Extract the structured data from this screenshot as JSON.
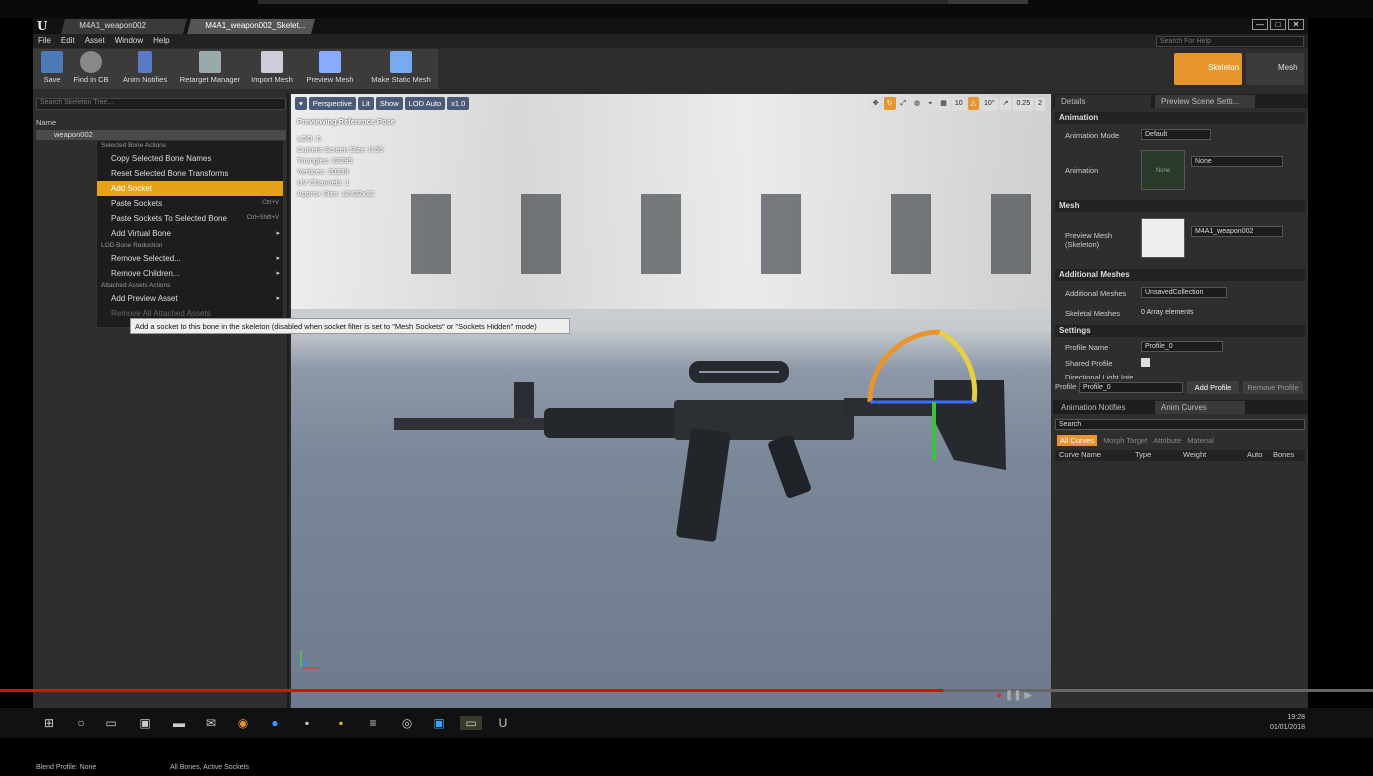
{
  "window": {
    "tabs": [
      "M4A1_weapon002",
      "M4A1_weapon002_Skelet..."
    ],
    "help_search": "Search For Help",
    "win_buttons": [
      "—",
      "□",
      "✕"
    ]
  },
  "menu": [
    "File",
    "Edit",
    "Asset",
    "Window",
    "Help"
  ],
  "toolbar": {
    "save": "Save",
    "find_in_cb": "Find in CB",
    "anim_notifies": "Anim Notifies",
    "retarget_manager": "Retarget Manager",
    "import_mesh": "Import Mesh",
    "preview_mesh": "Preview Mesh",
    "make_static_mesh": "Make Static Mesh"
  },
  "modes": {
    "skeleton": "Skeleton",
    "mesh": "Mesh"
  },
  "skeleton_tree": {
    "search_placeholder": "Search Skeleton Tree...",
    "column_name": "Name",
    "root_bone": "weapon002",
    "footer_left": "Blend Profile: None",
    "footer_right": "All Bones, Active Sockets"
  },
  "context_menu": {
    "sections": [
      {
        "header": "Selected Bone Actions",
        "items": [
          {
            "label": "Copy Selected Bone Names"
          },
          {
            "label": "Reset Selected Bone Transforms"
          },
          {
            "label": "Add Socket",
            "selected": true
          },
          {
            "label": "Paste Sockets",
            "shortcut": "Ctrl+V"
          },
          {
            "label": "Paste Sockets To Selected Bone",
            "shortcut": "Ctrl+Shift+V"
          },
          {
            "label": "Add Virtual Bone",
            "submenu": true
          }
        ]
      },
      {
        "header": "LOD Bone Reduction",
        "items": [
          {
            "label": "Remove Selected...",
            "submenu": true
          },
          {
            "label": "Remove Children...",
            "submenu": true
          }
        ]
      },
      {
        "header": "Attached Assets Actions",
        "items": [
          {
            "label": "Add Preview Asset",
            "submenu": true
          },
          {
            "label": "Remove All Attached Assets",
            "disabled": true
          }
        ]
      }
    ]
  },
  "tooltip": "Add a socket to this bone in the skeleton (disabled when socket filter is set to \"Mesh Sockets\" or \"Sockets Hidden\" mode)",
  "viewport": {
    "perspective": "Perspective",
    "lit": "Lit",
    "show": "Show",
    "lod": "LOD Auto",
    "speed": "x1.0",
    "info_title": "Previewing Reference Pose",
    "info_lines": [
      "LOD: 0",
      "Current Screen Size: 0.55",
      "Triangles: 23295",
      "Vertices: 20239",
      "UV Channels: 1",
      "Approx Size: 12x32x12"
    ],
    "grid_snap": "10",
    "rot_snap": "10°",
    "scale_snap": "0.25",
    "cam_speed": "2"
  },
  "details": {
    "tab_details": "Details",
    "tab_preview": "Preview Scene Setti...",
    "animation_section": "Animation",
    "animation_mode_label": "Animation Mode",
    "animation_mode_value": "Default",
    "animation_label": "Animation",
    "animation_value": "None",
    "animation_thumb": "None",
    "mesh_section": "Mesh",
    "preview_mesh_label": "Preview Mesh (Skeleton)",
    "preview_mesh_value": "M4A1_weapon002",
    "additional_section": "Additional Meshes",
    "additional_label": "Additional Meshes",
    "additional_value": "UnsavedCollection",
    "skeletal_label": "Skeletal Meshes",
    "skeletal_value": "0 Array elements",
    "settings_section": "Settings",
    "profile_name_label": "Profile Name",
    "profile_name_value": "Profile_0",
    "shared_profile_label": "Shared Profile",
    "directional_label": "Directional Light Inte...",
    "directional_value": "1.0",
    "profile_label": "Profile",
    "profile_value": "Profile_0",
    "add_profile": "Add Profile",
    "remove_profile": "Remove Profile"
  },
  "curves": {
    "tab_notifies": "Animation Notifies",
    "tab_curves": "Anim Curves",
    "search_placeholder": "Search",
    "filters": [
      "All Curves",
      "Morph Target",
      "Attribute",
      "Material"
    ],
    "columns": [
      "Curve Name",
      "Type",
      "Weight",
      "Auto",
      "Bones"
    ]
  },
  "taskbar": {
    "time": "19:28",
    "date": "01/01/2018"
  },
  "video": {
    "progress": 0.687
  }
}
